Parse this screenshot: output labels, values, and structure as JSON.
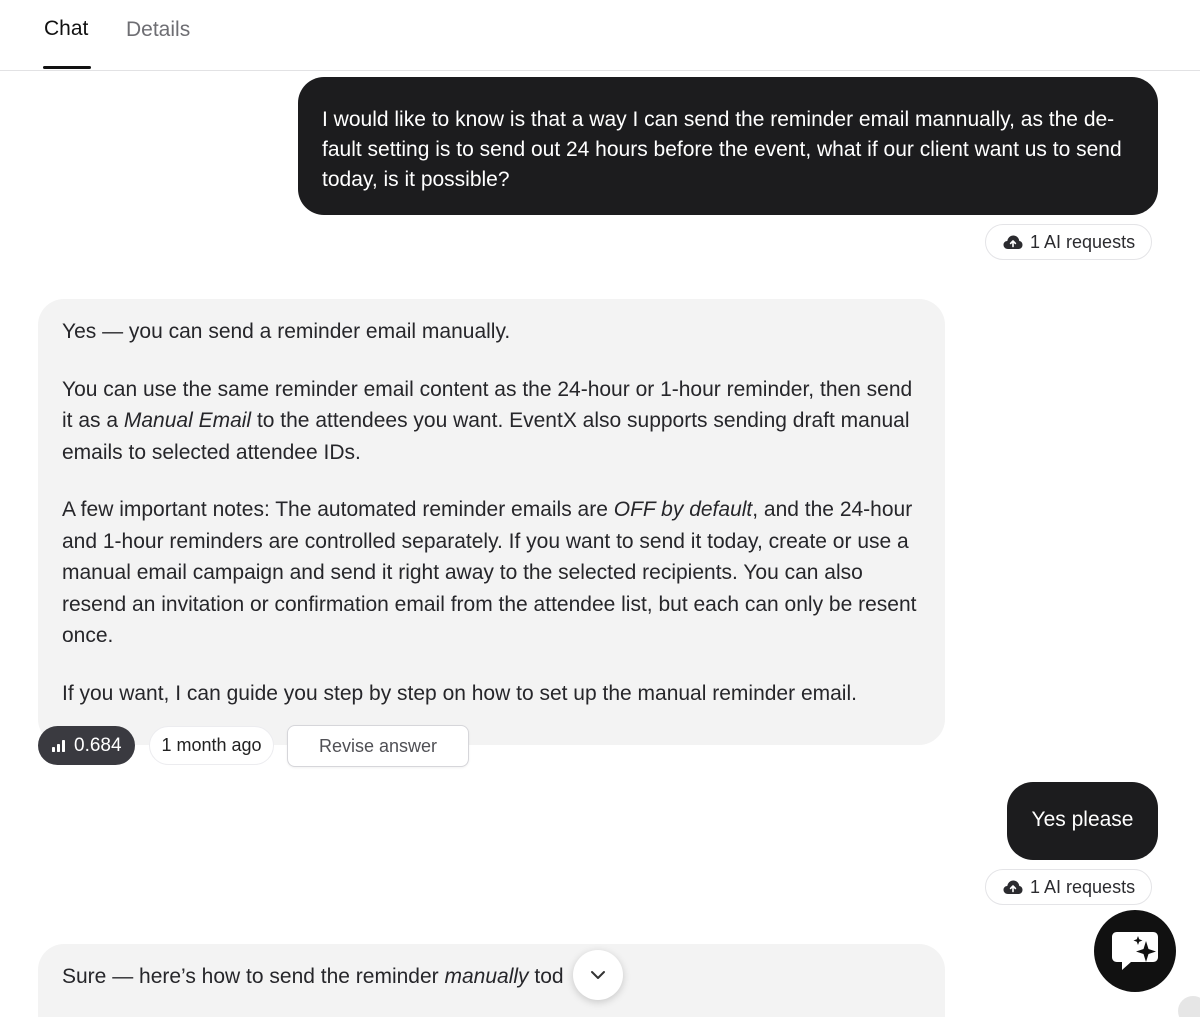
{
  "tabs": {
    "chat": "Chat",
    "details": "Details"
  },
  "messages": {
    "user1": "I would like to know is that a way I can send the reminder email mannually, as the de-fault setting is to send out 24 hours before the event, what if our client want us to send today, is it possible?",
    "req1": "1 AI requests",
    "ai1": {
      "p1": "Yes — you can send a reminder email manually.",
      "p2_a": "You can use the same reminder email content as the 24-hour or 1-hour reminder, then send it as a ",
      "p2_em": "Manual Email",
      "p2_b": " to the attendees you want. EventX also supports sending draft manual emails to selected attendee IDs.",
      "p3_a": "A few important notes: The automated reminder emails are ",
      "p3_em": "OFF by default",
      "p3_b": ", and the 24-hour and 1-hour reminders are controlled separately. If you want to send it today, create or use a manual email campaign and send it right away to the selected recipients. You can also resend an invitation or confirmation email from the attendee list, but each can only be resent once.",
      "p4": "If you want, I can guide you step by step on how to set up the manual reminder email."
    },
    "meta": {
      "score": "0.684",
      "time": "1 month ago",
      "revise": "Revise answer"
    },
    "user2": "Yes please",
    "req2": "1 AI requests",
    "ai2": {
      "a": "Sure — here’s how to send the reminder ",
      "em": "manually",
      "b": " tod"
    }
  },
  "icons": {
    "request": "cloud-upload-icon",
    "score": "signal-bars-icon",
    "scroll": "chevron-down-icon",
    "fab": "chat-sparkle-icon"
  },
  "colors": {
    "user_bubble": "#1c1c1e",
    "ai_bubble": "#f3f3f3",
    "score_chip": "#3a3a40"
  }
}
